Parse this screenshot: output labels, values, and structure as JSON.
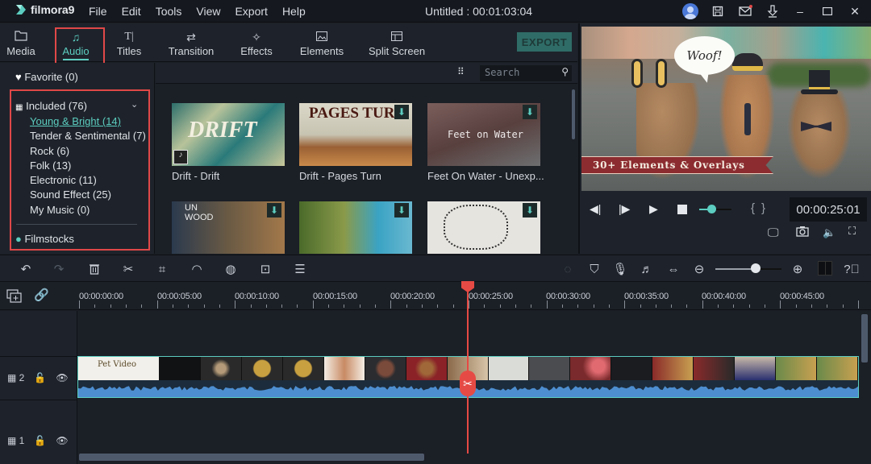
{
  "app": {
    "logo_text": "filmora9",
    "title": "Untitled : 00:01:03:04",
    "menu": [
      "File",
      "Edit",
      "Tools",
      "View",
      "Export",
      "Help"
    ],
    "window_icons": [
      "account-icon",
      "save-icon",
      "mail-icon",
      "download-icon",
      "minimize-icon",
      "maximize-icon",
      "close-icon"
    ],
    "accent_color": "#5ccdc0",
    "highlight_color": "#e04848"
  },
  "tabs": [
    {
      "label": "Media",
      "icon": "folder-icon",
      "active": false
    },
    {
      "label": "Audio",
      "icon": "music-note-icon",
      "active": true
    },
    {
      "label": "Titles",
      "icon": "text-icon",
      "active": false
    },
    {
      "label": "Transition",
      "icon": "transition-icon",
      "active": false
    },
    {
      "label": "Effects",
      "icon": "effects-icon",
      "active": false
    },
    {
      "label": "Elements",
      "icon": "image-icon",
      "active": false
    },
    {
      "label": "Split Screen",
      "icon": "split-screen-icon",
      "active": false
    }
  ],
  "export_label": "EXPORT",
  "sidebar": {
    "favorite": "Favorite (0)",
    "included": "Included (76)",
    "items": [
      {
        "label": "Young & Bright (14)",
        "selected": true
      },
      {
        "label": "Tender & Sentimental (7)",
        "selected": false
      },
      {
        "label": "Rock (6)",
        "selected": false
      },
      {
        "label": "Folk (13)",
        "selected": false
      },
      {
        "label": "Electronic (11)",
        "selected": false
      },
      {
        "label": "Sound Effect (25)",
        "selected": false
      },
      {
        "label": "My Music (0)",
        "selected": false
      }
    ],
    "filmstocks": "Filmstocks"
  },
  "library": {
    "search_placeholder": "Search",
    "items": [
      {
        "label": "Drift - Drift",
        "art_text": "DRIFT",
        "downloaded": true
      },
      {
        "label": "Drift - Pages Turn",
        "art_text": "PAGES TURN",
        "downloaded": false
      },
      {
        "label": "Feet On Water - Unexp...",
        "art_text": "Feet on Water",
        "downloaded": false
      },
      {
        "label": "",
        "art_text": "UN WOOD",
        "downloaded": false
      },
      {
        "label": "",
        "art_text": "",
        "downloaded": false
      },
      {
        "label": "",
        "art_text": "",
        "downloaded": false
      }
    ]
  },
  "preview": {
    "speech_bubble": "Woof!",
    "banner": "30+ Elements & Overlays",
    "timecode": "00:00:25:01",
    "volume_level": 0.3
  },
  "toolbar": {
    "left_tools": [
      "undo-icon",
      "redo-icon",
      "delete-icon",
      "cut-icon",
      "crop-icon",
      "speed-icon",
      "color-icon",
      "green-screen-icon",
      "adjust-icon"
    ],
    "right_tools": [
      "render-icon",
      "marker-icon",
      "microphone-icon",
      "audio-mixer-icon",
      "fit-icon",
      "zoom-out-icon",
      "zoom-in-icon",
      "layout-icon",
      "help-icon"
    ],
    "zoom_level": 0.6
  },
  "timeline": {
    "ticks": [
      "00:00:00:00",
      "00:00:05:00",
      "00:00:10:00",
      "00:00:15:00",
      "00:00:20:00",
      "00:00:25:00",
      "00:00:30:00",
      "00:00:35:00",
      "00:00:40:00",
      "00:00:45:00"
    ],
    "tracks": [
      {
        "number": "2",
        "clip_title": "Pet Video"
      },
      {
        "number": "1",
        "clip_title": ""
      }
    ],
    "playhead_time": "00:00:25:01"
  }
}
